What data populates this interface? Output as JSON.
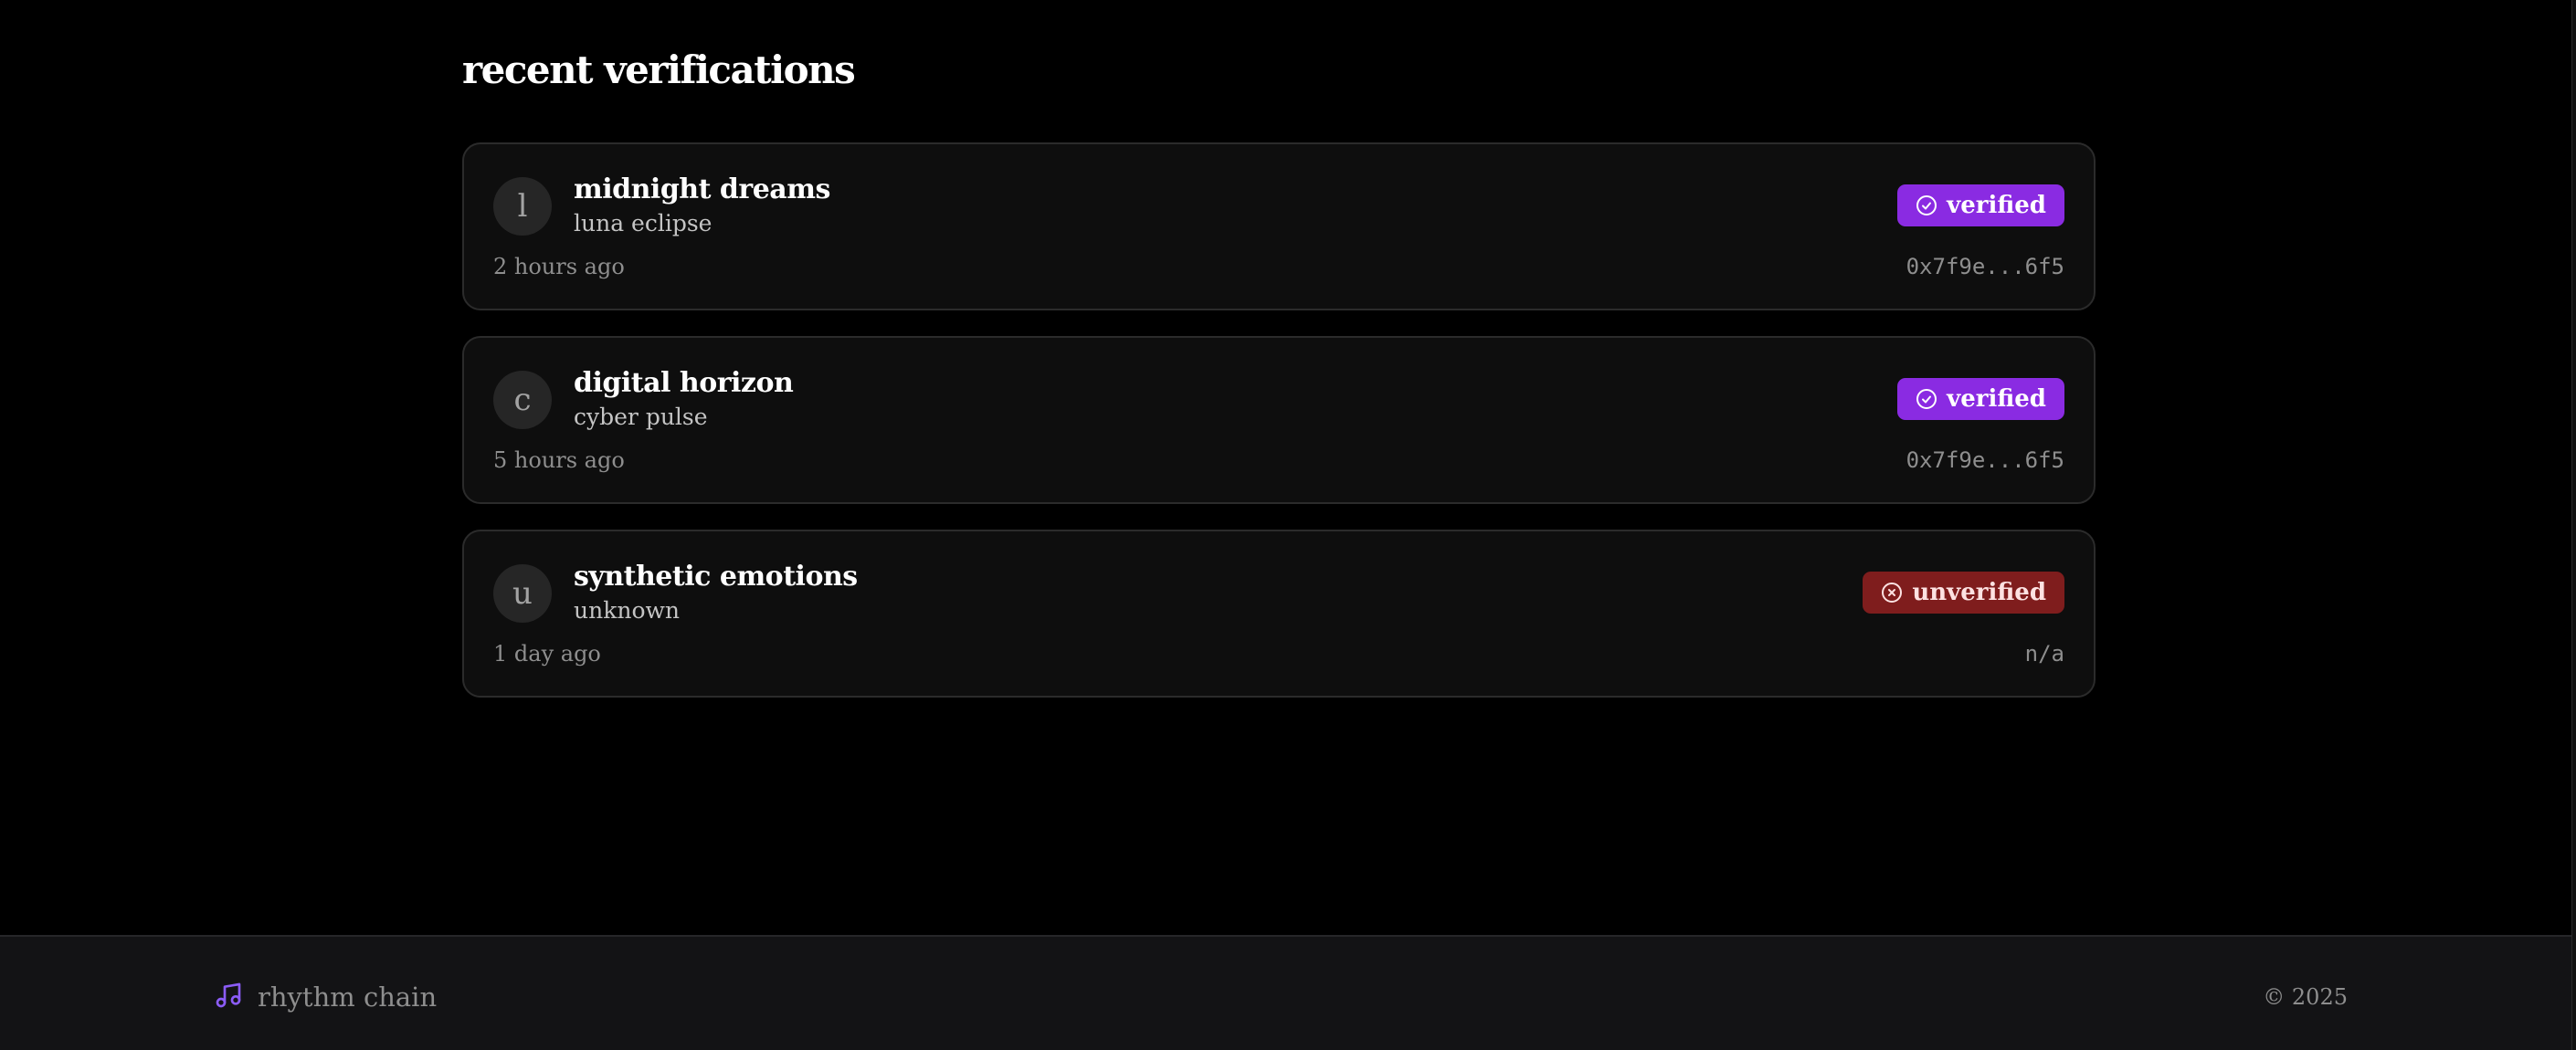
{
  "main": {
    "title": "recent verifications",
    "verifications": [
      {
        "avatar_letter": "l",
        "title": "midnight dreams",
        "artist": "luna eclipse",
        "time": "2 hours ago",
        "status": "verified",
        "status_icon": "check-circle-icon",
        "hash": "0x7f9e...6f5"
      },
      {
        "avatar_letter": "c",
        "title": "digital horizon",
        "artist": "cyber pulse",
        "time": "5 hours ago",
        "status": "verified",
        "status_icon": "check-circle-icon",
        "hash": "0x7f9e...6f5"
      },
      {
        "avatar_letter": "u",
        "title": "synthetic emotions",
        "artist": "unknown",
        "time": "1 day ago",
        "status": "unverified",
        "status_icon": "x-circle-icon",
        "hash": "n/a"
      }
    ]
  },
  "footer": {
    "brand_icon": "music-note-icon",
    "brand_name": "rhythm chain",
    "copyright": "© 2025"
  },
  "colors": {
    "background": "#000000",
    "card": "#0e0e0e",
    "verified": "#8a2be2",
    "unverified": "#7f1d1d",
    "brand_icon": "#8b5cf6",
    "footer": "#131315"
  }
}
